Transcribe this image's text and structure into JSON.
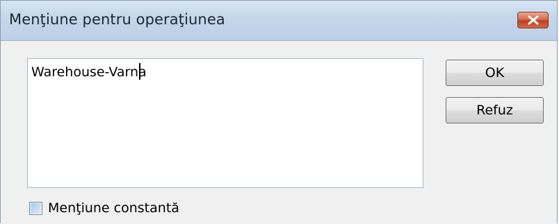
{
  "window": {
    "title": "Menţiune pentru operaţiunea"
  },
  "memo": {
    "value": "Warehouse-Varna"
  },
  "buttons": {
    "ok_label": "OK",
    "refuz_label": "Refuz"
  },
  "checkbox": {
    "label": "Menţiune constantă",
    "checked": false
  },
  "icons": {
    "close": "close-icon"
  },
  "colors": {
    "titlebar": "#c5d6ea",
    "close_button": "#c1401e",
    "client_background": "#f0f0f0"
  }
}
